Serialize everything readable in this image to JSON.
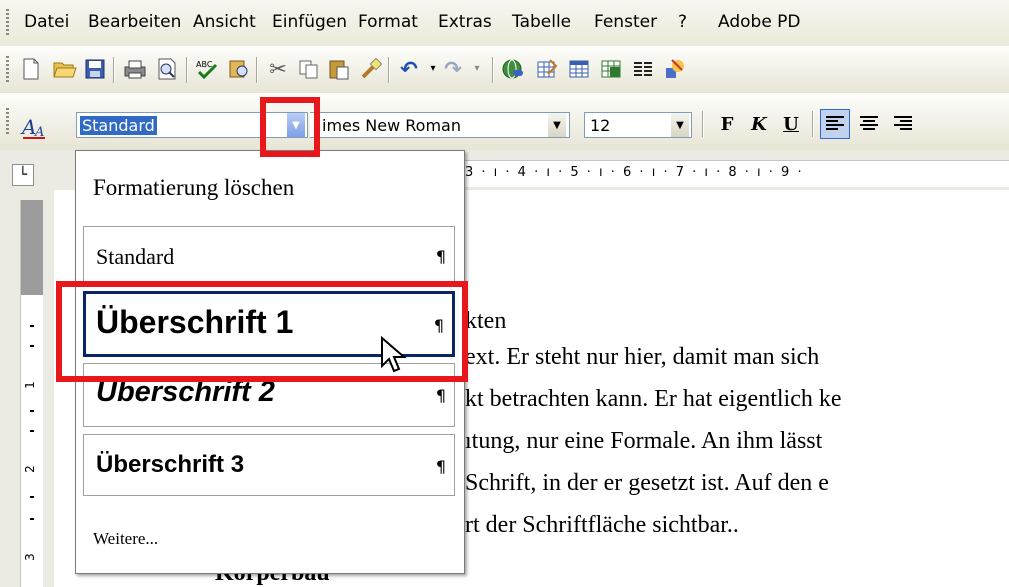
{
  "menubar": {
    "items": [
      {
        "label": "Datei"
      },
      {
        "label": "Bearbeiten"
      },
      {
        "label": "Ansicht"
      },
      {
        "label": "Einfügen"
      },
      {
        "label": "Format"
      },
      {
        "label": "Extras"
      },
      {
        "label": "Tabelle"
      },
      {
        "label": "Fenster"
      },
      {
        "label": "?"
      },
      {
        "label": "Adobe PD"
      }
    ]
  },
  "toolbar": {
    "icons": [
      "new-document-icon",
      "open-folder-icon",
      "save-icon",
      "print-icon",
      "print-preview-icon",
      "spellcheck-icon",
      "research-icon",
      "cut-icon",
      "copy-icon",
      "paste-icon",
      "format-painter-icon",
      "undo-icon",
      "redo-icon",
      "hyperlink-icon",
      "tables-borders-icon",
      "insert-table-icon",
      "insert-excel-icon",
      "columns-icon",
      "drawing-icon"
    ]
  },
  "format_toolbar": {
    "style_value": "Standard",
    "font_value": "imes New Roman",
    "size_value": "12",
    "bold": "F",
    "italic": "K",
    "underline": "U"
  },
  "ruler": {
    "text": "3 · ı · 4 · ı · 5 · ı · 6 · ı · 7 · ı · 8 · ı · 9 ·",
    "vertical_numbers": [
      "1",
      "2",
      "3"
    ]
  },
  "document": {
    "lines": [
      "kten",
      "ext. Er steht nur hier, damit man sich",
      "kt betrachten kann. Er hat eigentlich ke",
      "ıtung, nur eine Formale. An ihm lässt",
      "Schrift, in der er gesetzt ist. Auf den e",
      "rt der Schriftfläche sichtbar..",
      "Körperbau"
    ]
  },
  "style_dropdown": {
    "clear": "Formatierung löschen",
    "styles": [
      {
        "label": "Standard",
        "mark": "¶"
      },
      {
        "label": "Überschrift 1",
        "mark": "¶"
      },
      {
        "label": "Überschrift 2",
        "mark": "¶"
      },
      {
        "label": "Überschrift 3",
        "mark": "¶"
      }
    ],
    "more": "Weitere..."
  },
  "colors": {
    "highlight": "#e8171c",
    "selection_border": "#0a246a",
    "style_field_selection": "#316ac5"
  }
}
